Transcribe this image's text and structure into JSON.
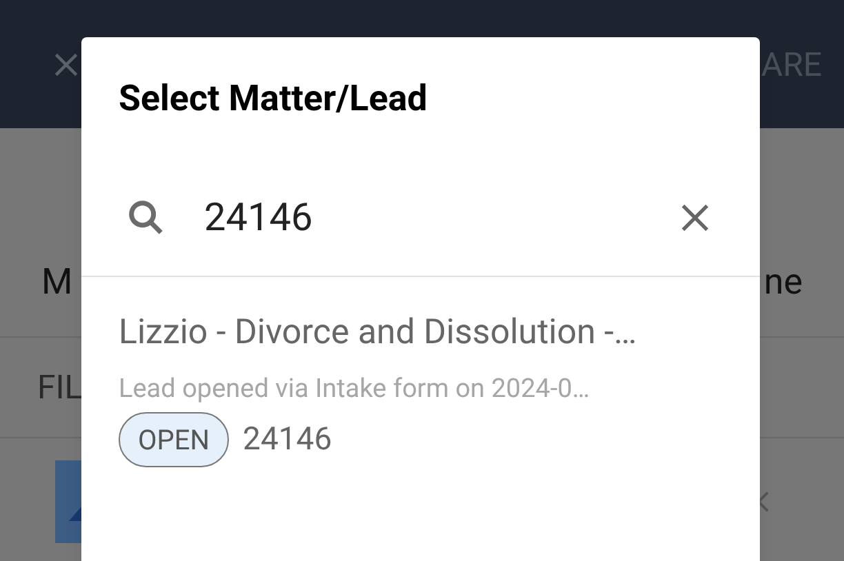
{
  "background": {
    "header_action": "ARE",
    "row_1_left": "M",
    "row_1_right": "ne",
    "row_2_left": "FIL"
  },
  "dialog": {
    "title": "Select Matter/Lead",
    "search": {
      "value": "24146"
    },
    "results": [
      {
        "title": "Lizzio - Divorce and Dissolution -…",
        "subtitle": "Lead opened via Intake form on 2024-0…",
        "status": "OPEN",
        "number": "24146"
      }
    ]
  }
}
